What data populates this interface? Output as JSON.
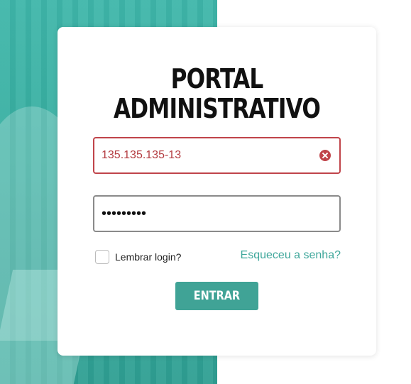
{
  "form": {
    "title_line1": "PORTAL",
    "title_line2": "ADMINISTRATIVO",
    "username_value": "135.135.135-13",
    "password_value": "•••••••••",
    "remember_label": "Lembrar login?",
    "forgot_label": "Esqueceu a senha?",
    "submit_label": "ENTRAR"
  },
  "colors": {
    "accent": "#40a396",
    "error": "#c0444a"
  },
  "icons": {
    "clear": "clear-icon"
  }
}
